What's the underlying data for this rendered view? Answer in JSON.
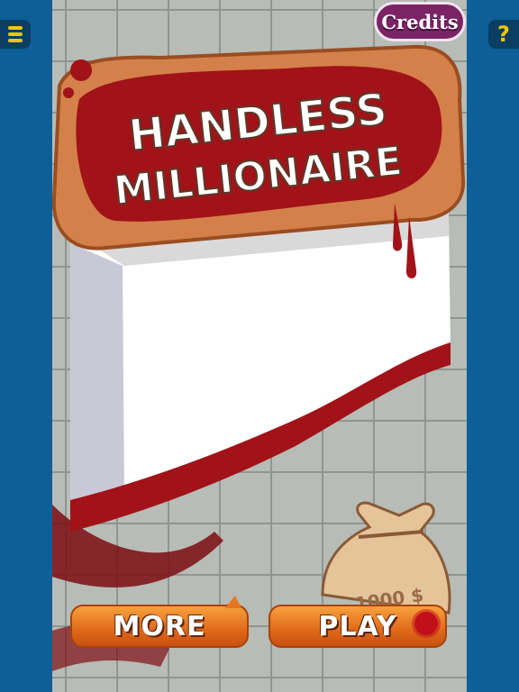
{
  "game": {
    "title_line1": "HANDLESS",
    "title_line2": "MILLIONAIRE"
  },
  "top_bar": {
    "credits_label": "Credits",
    "help_label": "?"
  },
  "bag": {
    "label": "1000 $"
  },
  "buttons": {
    "more_label": "MORE",
    "play_label": "PLAY"
  },
  "colors": {
    "side_bar": "#0e5f98",
    "button_orange": "#e0691a",
    "credits_purple": "#7a2466",
    "blood_red": "#a11318",
    "sign_wood": "#d4804a"
  }
}
